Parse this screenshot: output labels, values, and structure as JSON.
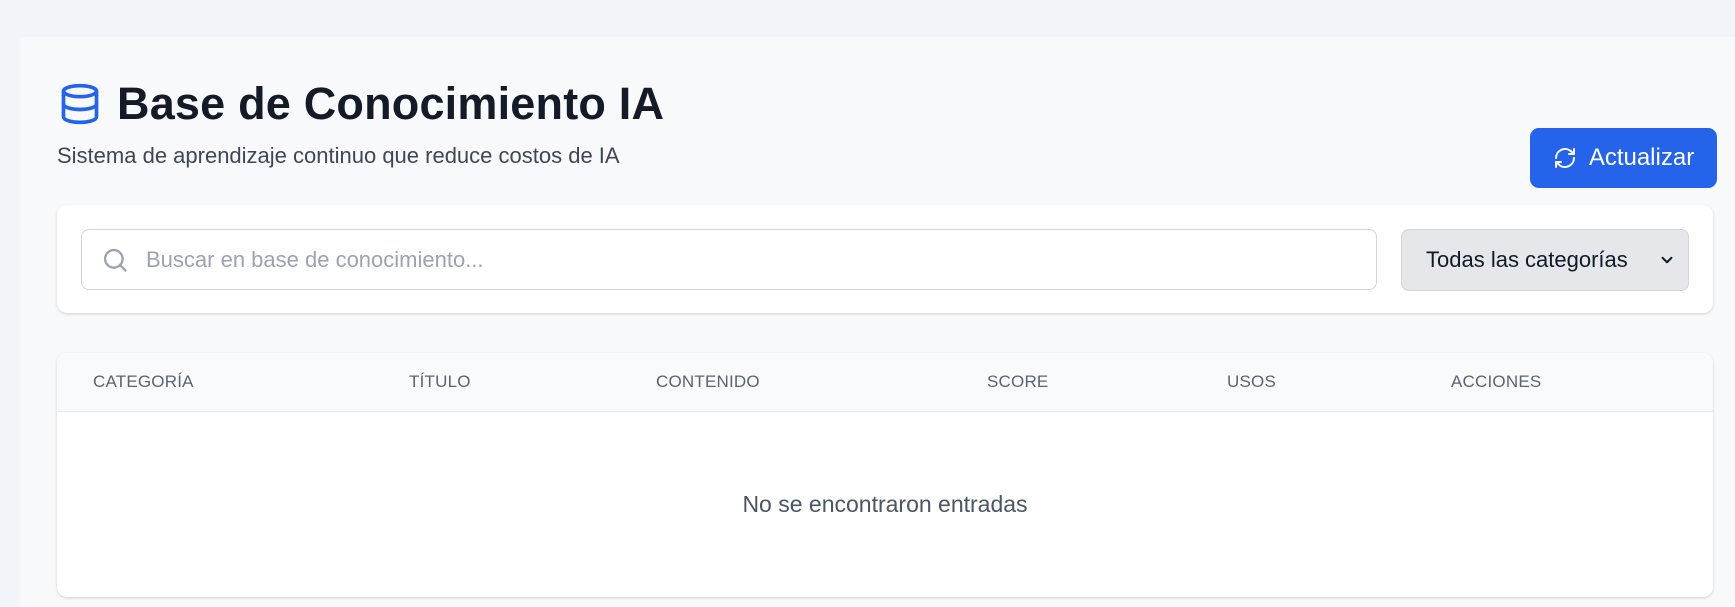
{
  "header": {
    "icon": "database-icon",
    "title": "Base de Conocimiento IA",
    "subtitle": "Sistema de aprendizaje continuo que reduce costos de IA",
    "refresh_label": "Actualizar",
    "refresh_icon": "refresh-icon"
  },
  "filters": {
    "search_placeholder": "Buscar en base de conocimiento...",
    "search_value": "",
    "category_selected": "Todas las categorías"
  },
  "table": {
    "columns": [
      "CATEGORÍA",
      "TÍTULO",
      "CONTENIDO",
      "SCORE",
      "USOS",
      "ACCIONES"
    ],
    "rows": [],
    "empty_message": "No se encontraron entradas"
  },
  "colors": {
    "accent": "#2563eb",
    "page_background": "#f1f4f8",
    "card_background": "#ffffff"
  }
}
